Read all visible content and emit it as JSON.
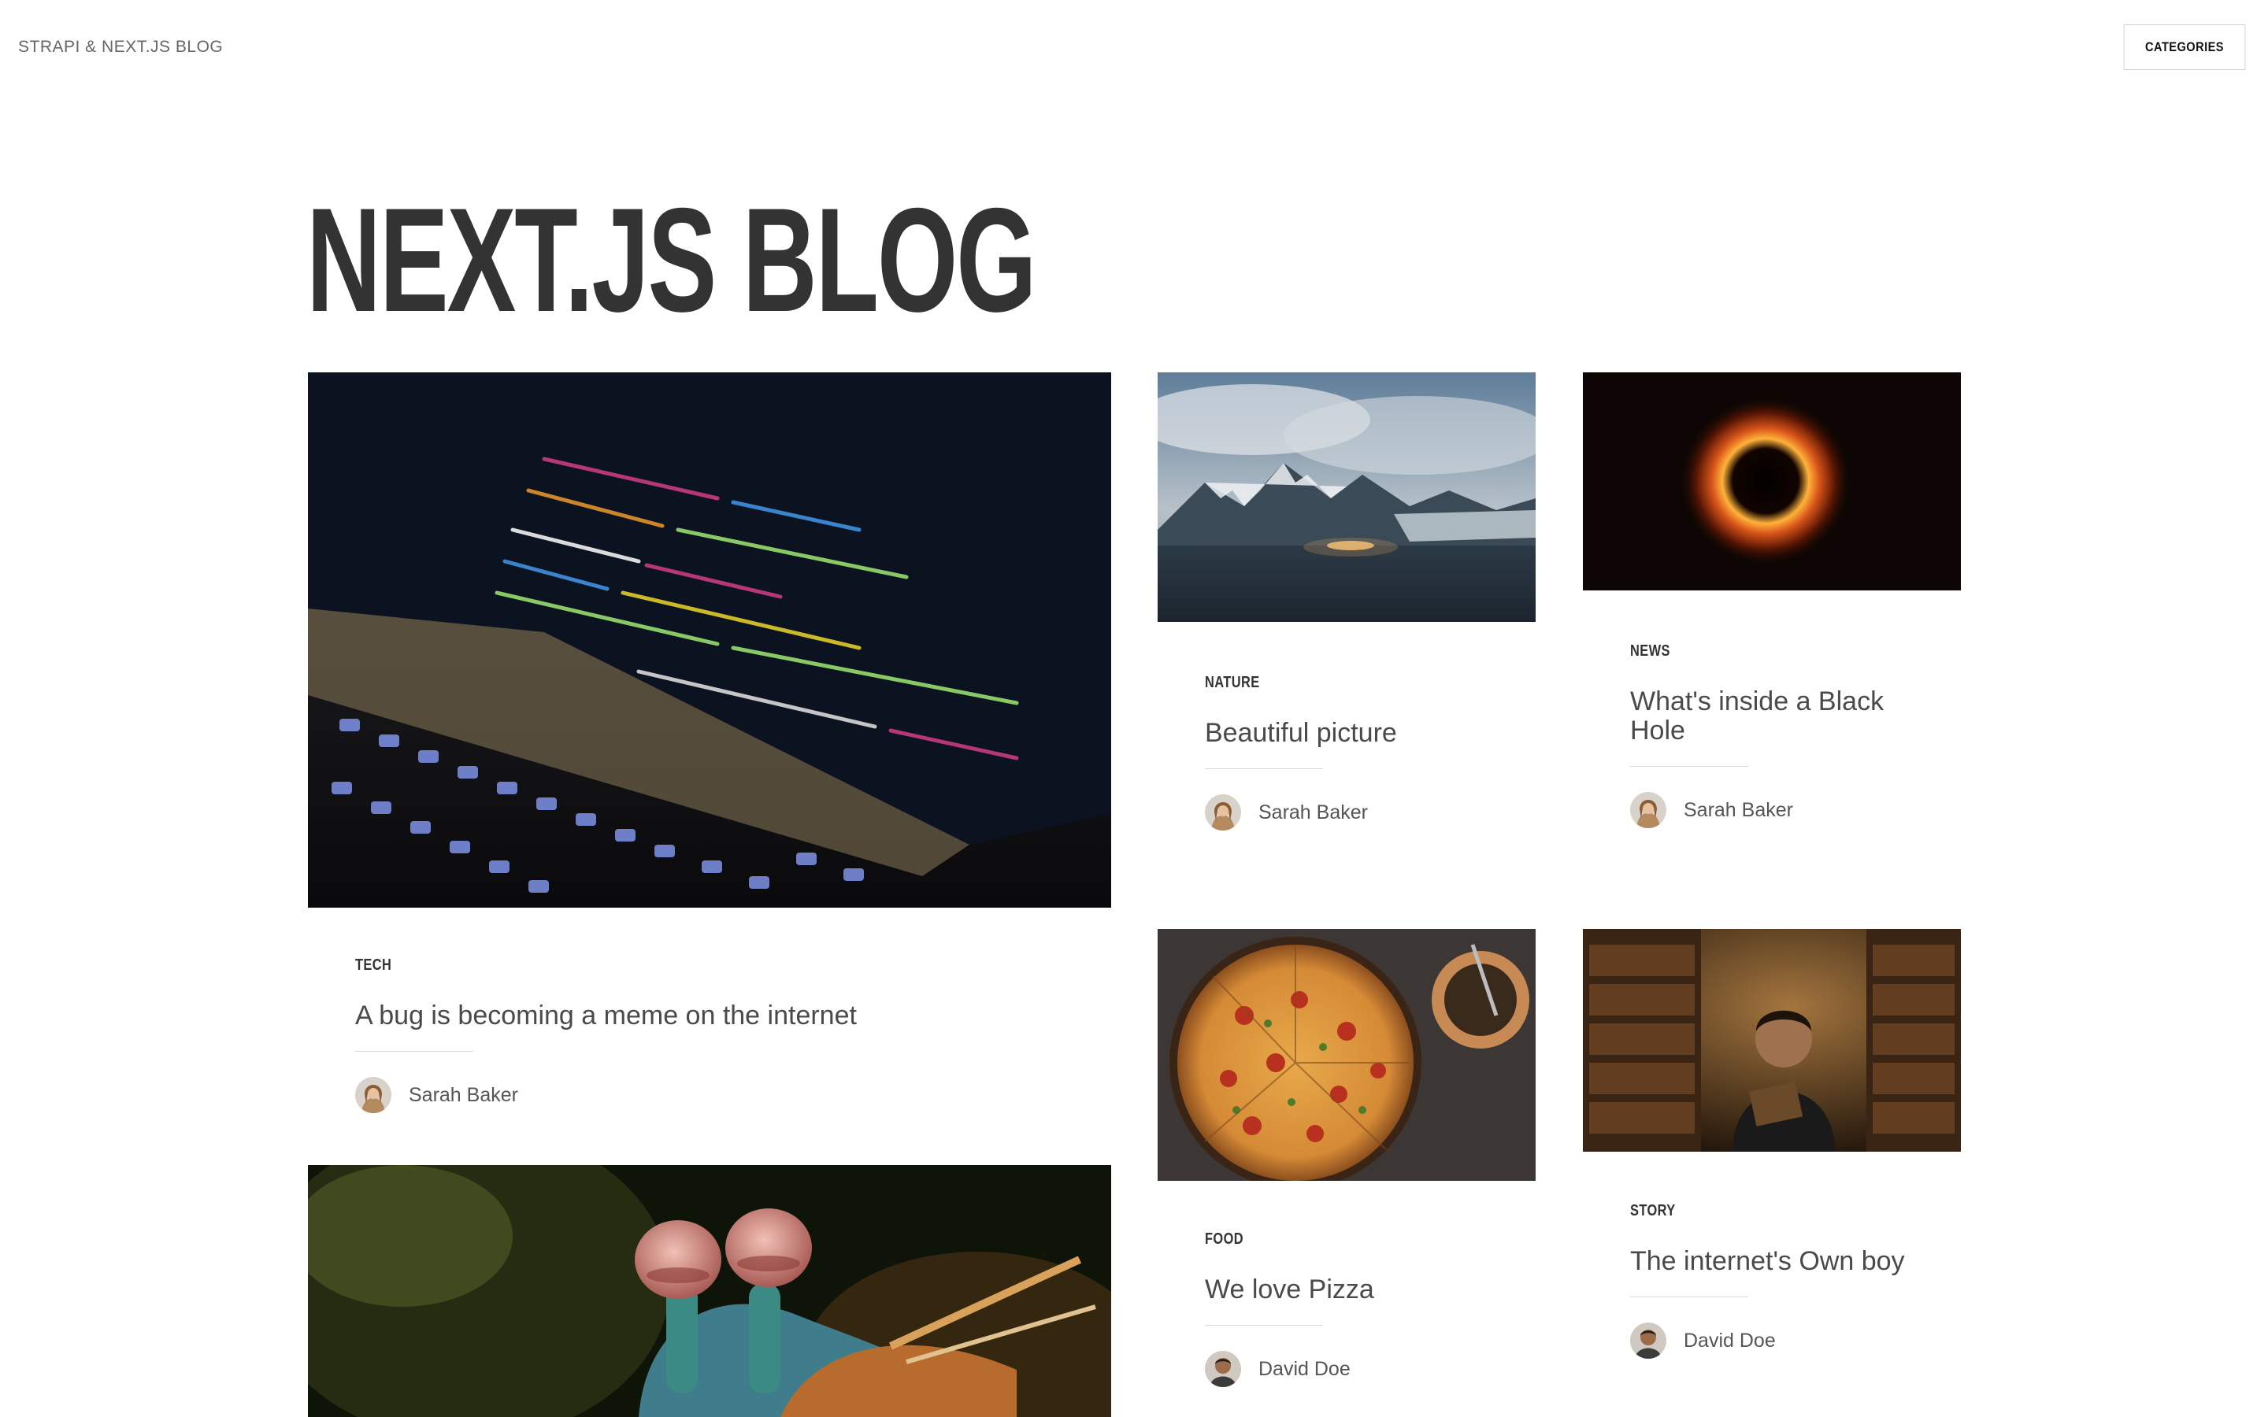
{
  "header": {
    "site_title": "STRAPI & NEXT.JS BLOG",
    "categories_button": "CATEGORIES"
  },
  "hero": {
    "title": "NEXT.JS BLOG"
  },
  "articles": [
    {
      "category": "TECH",
      "title": "A bug is becoming a meme on the internet",
      "author": "Sarah Baker"
    },
    {
      "category": "NATURE",
      "title": "Beautiful picture",
      "author": "Sarah Baker"
    },
    {
      "category": "NEWS",
      "title": "What's inside a Black Hole",
      "author": "Sarah Baker"
    },
    {
      "category": "FOOD",
      "title": "We love Pizza",
      "author": "David Doe"
    },
    {
      "category": "STORY",
      "title": "The internet's Own boy",
      "author": "David Doe"
    }
  ],
  "colors": {
    "background": "#ffffff",
    "text": "#333333",
    "divider": "#d9d9d9"
  },
  "icons": {
    "article_1_image": "laptop-code-photo",
    "article_2_image": "mountain-landscape-photo",
    "article_3_image": "black-hole-photo",
    "article_4_image": "pizza-photo",
    "article_5_image": "library-reader-photo",
    "article_6_image": "mantis-shrimp-photo",
    "avatar_sarah": "avatar-woman",
    "avatar_david": "avatar-man"
  }
}
